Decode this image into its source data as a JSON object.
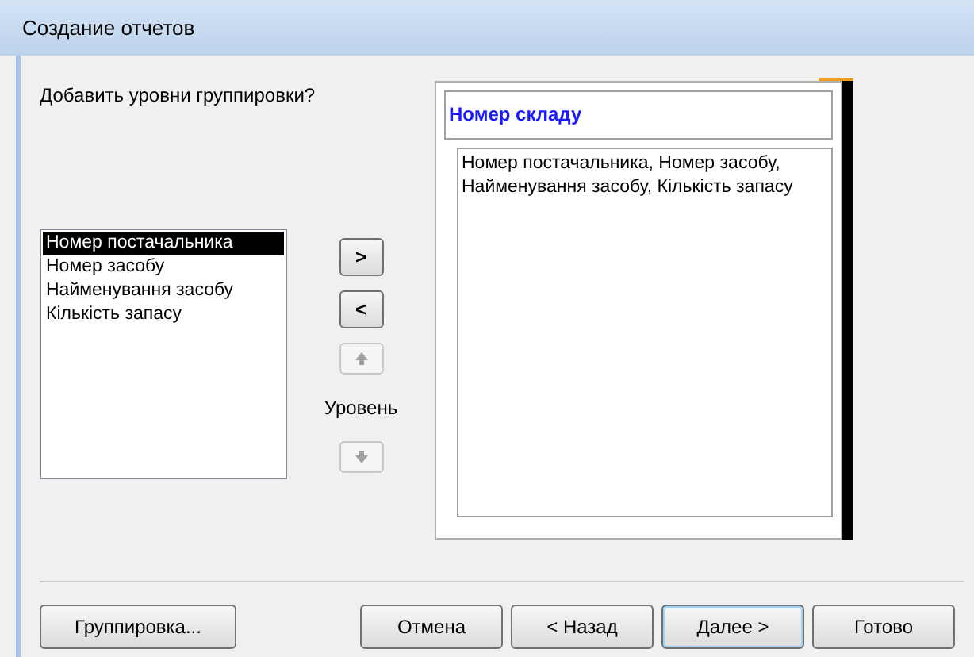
{
  "window": {
    "title": "Создание отчетов"
  },
  "prompt": "Добавить уровни группировки?",
  "fields": [
    {
      "label": "Номер постачальника",
      "selected": true
    },
    {
      "label": "Номер засобу",
      "selected": false
    },
    {
      "label": "Найменування засобу",
      "selected": false
    },
    {
      "label": "Кількість запасу",
      "selected": false
    }
  ],
  "move_buttons": [
    {
      "label": ">",
      "kind": "text",
      "disabled": false
    },
    {
      "label": "<",
      "kind": "text",
      "disabled": false
    },
    {
      "kind": "up",
      "disabled": true
    },
    {
      "kind": "label",
      "label": "Уровень"
    },
    {
      "kind": "down",
      "disabled": true
    }
  ],
  "preview": {
    "group_header": "Номер складу",
    "detail": "Номер постачальника, Номер засобу, Найменування засобу, Кількість запасу"
  },
  "buttons": [
    {
      "label": "Группировка...",
      "default": false
    },
    {
      "label": "Отмена",
      "default": false
    },
    {
      "label": "< Назад",
      "default": false
    },
    {
      "label": "Далее >",
      "default": true
    },
    {
      "label": "Готово",
      "default": false
    }
  ]
}
